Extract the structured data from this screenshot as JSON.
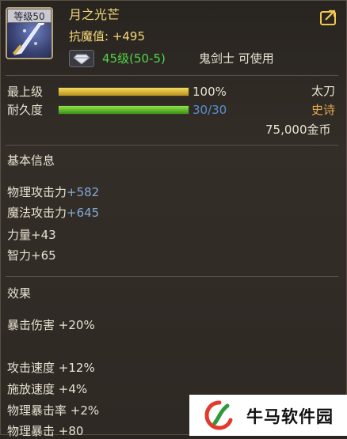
{
  "header": {
    "level_badge": "等级50",
    "item_name": "月之光芒",
    "anti_magic": "抗魔值: +495",
    "requirement_level": "45级(50-5)",
    "requirement_class": "鬼剑士 可使用"
  },
  "bars": {
    "max_level_label": "最上级",
    "max_level_value": "100%",
    "max_level_fraction": 1.0,
    "durability_label": "耐久度",
    "durability_value": "30/30",
    "durability_fraction": 1.0
  },
  "info": {
    "weapon_type": "太刀",
    "rarity": "史诗",
    "price": "75,000金币"
  },
  "basic": {
    "heading": "基本信息",
    "stats": [
      {
        "name": "物理攻击力",
        "value": "+582"
      },
      {
        "name": "魔法攻击力",
        "value": "+645"
      },
      {
        "name": "力量",
        "value": "+43"
      },
      {
        "name": "智力",
        "value": "+65"
      }
    ]
  },
  "effects": {
    "heading": "效果",
    "stats": [
      {
        "name": "暴击伤害",
        "value": "+20%"
      },
      {
        "name": "攻击速度",
        "value": "+12%"
      },
      {
        "name": "施放速度",
        "value": "+4%"
      },
      {
        "name": "物理暴击率",
        "value": "+2%"
      },
      {
        "name": "物理暴击",
        "value": "+80"
      }
    ]
  },
  "watermark": {
    "text": "牛马软件园"
  },
  "colors": {
    "title_gold": "#f4d879",
    "requirement_green": "#53d34a",
    "durability_blue": "#5a90cf",
    "rarity_orange": "#e8a84d",
    "stat_blue": "#83a9d8"
  },
  "icons": [
    "sword-item-icon",
    "gem-icon",
    "export-icon",
    "watermark-logo-icon"
  ]
}
